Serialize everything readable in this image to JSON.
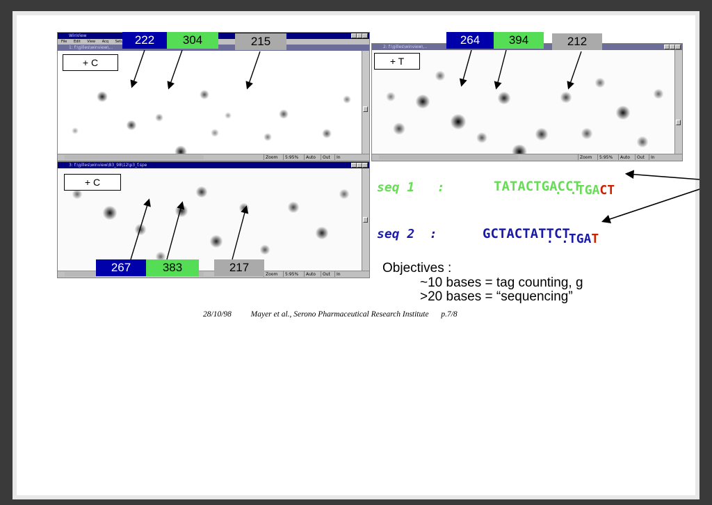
{
  "app_title": "WinView",
  "menu": [
    "File",
    "Edit",
    "View",
    "Acq",
    "Setup"
  ],
  "windows": {
    "top_left": {
      "title": "1: f:\\gilles\\winview\\...",
      "label": "+ C",
      "numbers": [
        "222",
        "304",
        "215"
      ]
    },
    "top_right": {
      "title": "2: f:\\gilles\\winview\\...",
      "label": "+ T",
      "numbers": [
        "264",
        "394",
        "212"
      ]
    },
    "bottom_left": {
      "title": "3: f:\\gilles\\winview\\83_98\\12\\p3_f.spe",
      "label": "+ C",
      "numbers": [
        "267",
        "383",
        "217"
      ]
    }
  },
  "status_cells": [
    "Zoom",
    "5:95%",
    "Auto",
    "Out",
    "In"
  ],
  "seq1": {
    "label": "seq 1   :",
    "top_prefix": ". .TGA",
    "top_suffix": "CT",
    "sequence": "TATACTGACCT"
  },
  "seq2": {
    "label": "seq 2  :",
    "top_prefix": ". .TGA",
    "top_suffix": "T",
    "sequence": "GCTACTATTCT"
  },
  "objectives": {
    "heading": "Objectives :",
    "line1": "~10 bases = tag counting, g",
    "line2": ">20 bases = “sequencing”"
  },
  "footer": {
    "date": "28/10/98",
    "authors": "Mayer et al., Serono Pharmaceutical Research Institute",
    "page": "p.7/8"
  },
  "colors": {
    "blue": "#0000aa",
    "green": "#55dd55",
    "gray": "#aaaaaa",
    "red": "#cc2200",
    "seq_green": "#66dd55",
    "seq_blue": "#1a1aa8"
  }
}
